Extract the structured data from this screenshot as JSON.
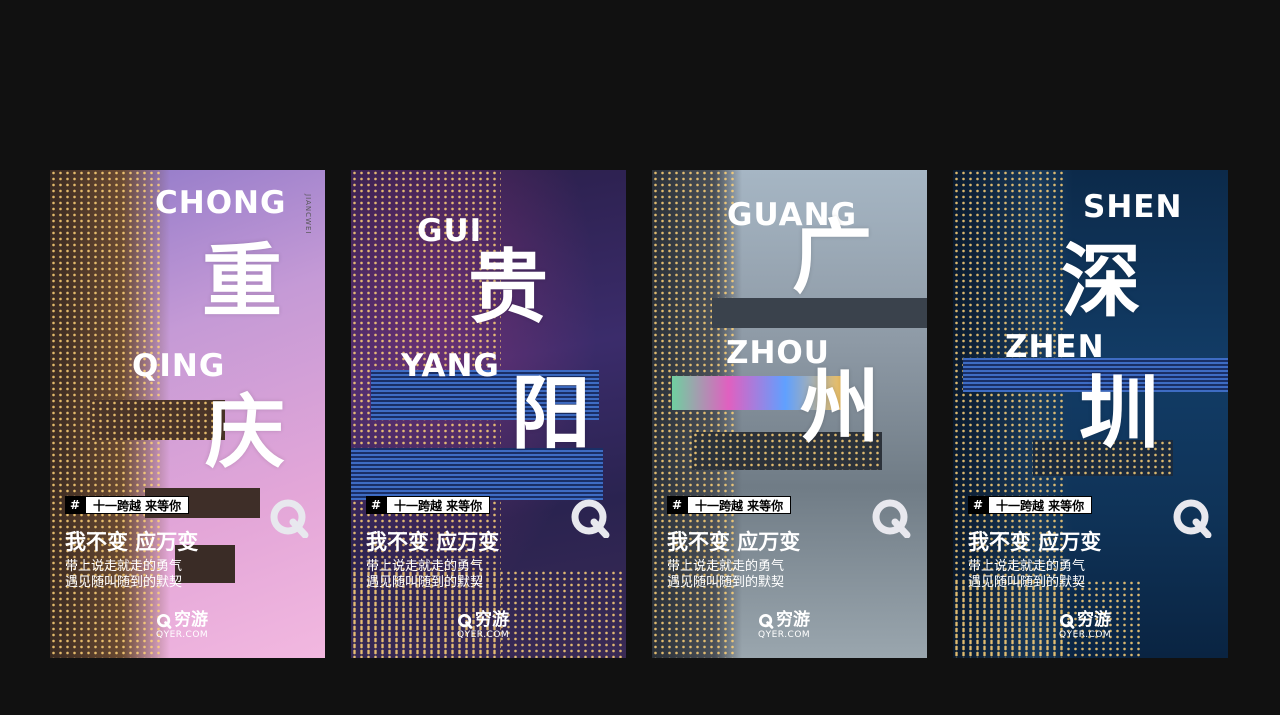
{
  "posters": [
    {
      "roman_top": "CHONG",
      "hanzi_top": "重",
      "roman_bottom": "QING",
      "hanzi_bottom": "庆",
      "side_mark": "JIANCWEI"
    },
    {
      "roman_top": "GUI",
      "hanzi_top": "贵",
      "roman_bottom": "YANG",
      "hanzi_bottom": "阳"
    },
    {
      "roman_top": "GUANG",
      "hanzi_top": "广",
      "roman_bottom": "ZHOU",
      "hanzi_bottom": "州"
    },
    {
      "roman_top": "SHEN",
      "hanzi_top": "深",
      "roman_bottom": "ZHEN",
      "hanzi_bottom": "圳"
    }
  ],
  "common": {
    "hash": "#",
    "tag_text": "十一跨越 来等你",
    "slogan": "我不变 应万变",
    "line1": "带上说走就走的勇气",
    "line2": "遇见随叫随到的默契",
    "brand_cn": "穷游",
    "brand_en": "QYER.COM"
  },
  "colors": {
    "page_bg": "#111111",
    "text": "#ffffff"
  }
}
